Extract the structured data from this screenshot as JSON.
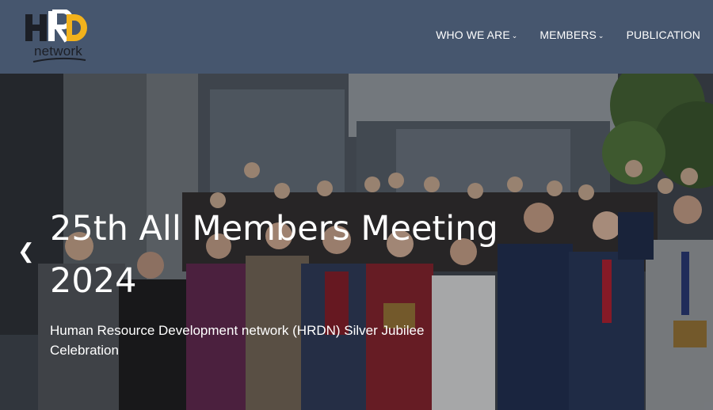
{
  "brand": {
    "logo_letters": "HRD",
    "logo_word": "network"
  },
  "nav": {
    "items": [
      {
        "label": "WHO WE ARE",
        "has_dropdown": true
      },
      {
        "label": "MEMBERS",
        "has_dropdown": true
      },
      {
        "label": "PUBLICATION",
        "has_dropdown": false
      }
    ],
    "dropdown_icon": "chevron-down-icon"
  },
  "slider": {
    "title": "25th All Members Meeting 2024",
    "subtitle": "Human Resource Development network (HRDN) Silver Jubilee Celebration",
    "prev_icon": "chevron-left-icon"
  },
  "colors": {
    "header_bg": "#46566e",
    "logo_accent": "#f2b21c",
    "text": "#ffffff"
  }
}
